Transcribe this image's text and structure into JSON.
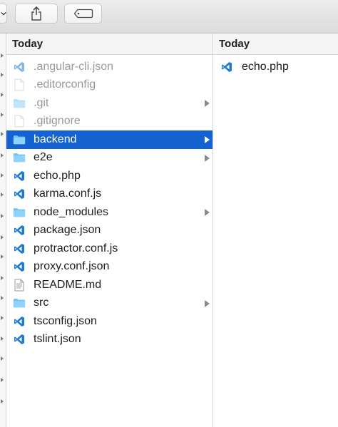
{
  "toolbar": {
    "share_icon": "share-icon",
    "tag_icon": "tag-icon"
  },
  "column1": {
    "header": "Today",
    "items": [
      {
        "label": ".angular-cli.json",
        "icon": "vscode-file-icon",
        "dim": true,
        "folder": false
      },
      {
        "label": ".editorconfig",
        "icon": "blank-file-icon",
        "dim": true,
        "folder": false
      },
      {
        "label": ".git",
        "icon": "folder-icon",
        "dim": true,
        "folder": true
      },
      {
        "label": ".gitignore",
        "icon": "blank-file-icon",
        "dim": true,
        "folder": false
      },
      {
        "label": "backend",
        "icon": "folder-icon",
        "dim": false,
        "folder": true,
        "selected": true
      },
      {
        "label": "e2e",
        "icon": "folder-icon",
        "dim": false,
        "folder": true
      },
      {
        "label": "echo.php",
        "icon": "vscode-file-icon",
        "dim": false,
        "folder": false
      },
      {
        "label": "karma.conf.js",
        "icon": "vscode-file-icon",
        "dim": false,
        "folder": false
      },
      {
        "label": "node_modules",
        "icon": "folder-icon",
        "dim": false,
        "folder": true
      },
      {
        "label": "package.json",
        "icon": "vscode-file-icon",
        "dim": false,
        "folder": false
      },
      {
        "label": "protractor.conf.js",
        "icon": "vscode-file-icon",
        "dim": false,
        "folder": false
      },
      {
        "label": "proxy.conf.json",
        "icon": "vscode-file-icon",
        "dim": false,
        "folder": false
      },
      {
        "label": "README.md",
        "icon": "text-file-icon",
        "dim": false,
        "folder": false
      },
      {
        "label": "src",
        "icon": "folder-icon",
        "dim": false,
        "folder": true
      },
      {
        "label": "tsconfig.json",
        "icon": "vscode-file-icon",
        "dim": false,
        "folder": false
      },
      {
        "label": "tslint.json",
        "icon": "vscode-file-icon",
        "dim": false,
        "folder": false
      }
    ]
  },
  "column2": {
    "header": "Today",
    "items": [
      {
        "label": "echo.php",
        "icon": "vscode-file-icon",
        "dim": false,
        "folder": false
      }
    ]
  },
  "colors": {
    "selection": "#1563d3",
    "folder": "#6cc4f5",
    "vscode_blue": "#1e7ad2"
  }
}
